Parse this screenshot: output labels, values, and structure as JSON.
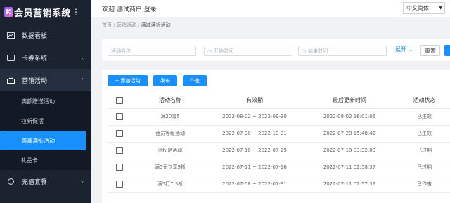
{
  "brand": {
    "logo_letter": "K",
    "title": "会员营销系统",
    "menu_dots": "⋮"
  },
  "sidebar": {
    "items": [
      {
        "label": "数据看板",
        "icon": "chart-icon"
      },
      {
        "label": "卡券系统",
        "icon": "ticket-icon",
        "caret": "⌄"
      },
      {
        "label": "营销活动",
        "icon": "gift-icon",
        "caret": "⌃",
        "open": true,
        "children": [
          {
            "label": "满额赠送活动"
          },
          {
            "label": "拉新促活"
          },
          {
            "label": "满减满折活动",
            "active": true
          },
          {
            "label": "礼品卡"
          }
        ]
      },
      {
        "label": "充值套餐",
        "icon": "wallet-icon",
        "caret": "⌄"
      }
    ]
  },
  "header": {
    "welcome": "欢迎 测试商户 登录",
    "language": "中文简体"
  },
  "breadcrumb": {
    "home": "首页",
    "sep1": "/",
    "parent": "营销活动",
    "sep2": "/",
    "current": "满减满折活动"
  },
  "search": {
    "name_placeholder": "活动名称",
    "start_placeholder": "开始时间",
    "end_placeholder": "结束时间",
    "expand_label": "展开",
    "expand_caret": "⌄",
    "reset_label": "重置"
  },
  "toolbar": {
    "add_label": "+ 添加活动",
    "publish_label": "发布",
    "void_label": "作废"
  },
  "table": {
    "headers": {
      "name": "活动名称",
      "valid": "有效期",
      "updated": "最后更新时间",
      "status": "活动状态"
    },
    "rows": [
      {
        "name": "满20减5",
        "valid": "2022-08-02 ~ 2022-09-30",
        "updated": "2022-08-02 16:01:06",
        "status": "已生效"
      },
      {
        "name": "会员等级活动",
        "valid": "2022-07-30 ~ 2022-10-31",
        "updated": "2022-07-28 15:48:42",
        "status": "已生效"
      },
      {
        "name": "测hi是活动",
        "valid": "2022-07-18 ~ 2022-07-29",
        "updated": "2022-07-18 03:32:09",
        "status": "已过期"
      },
      {
        "name": "满5元立享9折",
        "valid": "2022-07-11 ~ 2022-07-16",
        "updated": "2022-07-11 02:58:37",
        "status": "已过期"
      },
      {
        "name": "满5打7.5折",
        "valid": "2022-07-08 ~ 2022-07-31",
        "updated": "2022-07-11 02:57:39",
        "status": "已作废"
      }
    ]
  },
  "colors": {
    "sidebar_bg": "#1b2230",
    "accent": "#1990ff"
  }
}
